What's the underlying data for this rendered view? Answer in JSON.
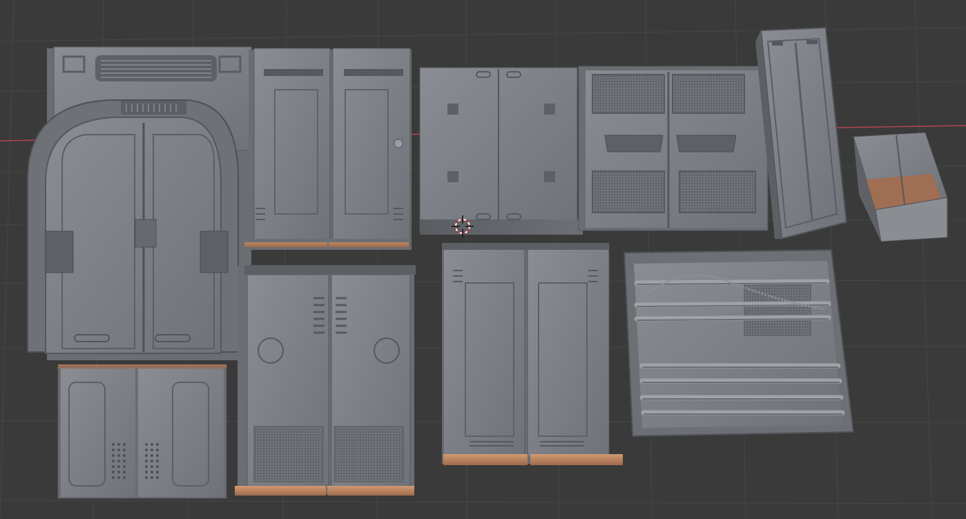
{
  "viewport": {
    "background": "#3a3a3a",
    "grid_color": "#474747",
    "x_axis_color": "#b34555",
    "mesh_base": "#7b7e84",
    "mesh_light": "#9a9da3",
    "mesh_dark": "#4e5156",
    "mesh_shadow": "#3d3f43",
    "accent_copper": "#c78a63",
    "cursor_color": "#d42a2a"
  },
  "objects": [
    {
      "name": "arched-sliding-door-panel"
    },
    {
      "name": "double-door-panel-top-vents"
    },
    {
      "name": "flat-wall-panel-brackets"
    },
    {
      "name": "mesh-grille-wall-panel"
    },
    {
      "name": "tall-pillar-column"
    },
    {
      "name": "small-crate-block"
    },
    {
      "name": "short-double-door-panel"
    },
    {
      "name": "double-door-panel-round-hatches"
    },
    {
      "name": "double-door-panel-center-seam"
    },
    {
      "name": "pipe-rack-wall-panel"
    }
  ],
  "icons": {
    "cursor": "3d-cursor-icon"
  }
}
